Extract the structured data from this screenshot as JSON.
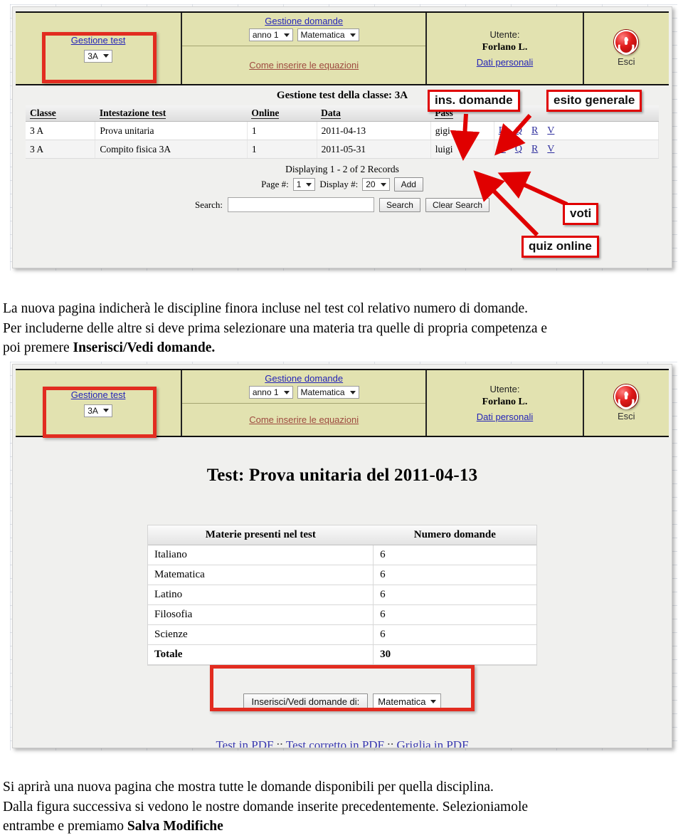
{
  "screenshot1": {
    "header": {
      "gestione_test_link": "Gestione test",
      "classe_select": "3A",
      "gestione_domande_link": "Gestione domande",
      "anno_select": "anno 1",
      "materia_select": "Matematica",
      "equazioni_link": "Come inserire le equazioni",
      "utente_label": "Utente:",
      "utente_name": "Forlano L.",
      "dati_personali_link": "Dati personali",
      "esci_label": "Esci",
      "power_icon": "power-icon"
    },
    "page_title": "Gestione test della classe: 3A",
    "table": {
      "columns": [
        "Classe",
        "Intestazione test",
        "Online",
        "Data",
        "Pass",
        ""
      ],
      "rows": [
        {
          "classe": "3 A",
          "intestazione": "Prova unitaria",
          "online": "1",
          "data": "2011-04-13",
          "pass": "gigi",
          "actions": [
            "D",
            "Q",
            "R",
            "V"
          ]
        },
        {
          "classe": "3 A",
          "intestazione": "Compito fisica 3A",
          "online": "1",
          "data": "2011-05-31",
          "pass": "luigi",
          "actions": [
            "D",
            "Q",
            "R",
            "V"
          ]
        }
      ]
    },
    "records_text": "Displaying 1 - 2 of 2 Records",
    "pager": {
      "page_label": "Page #:",
      "page_value": "1",
      "display_label": "Display #:",
      "display_value": "20",
      "add_button": "Add"
    },
    "search": {
      "label": "Search:",
      "value": "",
      "placeholder": "",
      "search_button": "Search",
      "clear_button": "Clear Search"
    },
    "annotations": [
      {
        "label": "ins. domande"
      },
      {
        "label": "esito generale"
      },
      {
        "label": "voti"
      },
      {
        "label": "quiz online"
      }
    ]
  },
  "paragraph1": {
    "line1": "La nuova pagina indicherà le discipline finora incluse nel test col relativo numero di domande.",
    "line2": "Per includerne delle altre si deve prima selezionare una materia tra quelle di propria competenza e",
    "line3_prefix": "poi premere ",
    "line3_bold": "Inserisci/Vedi domande."
  },
  "screenshot2": {
    "header": {
      "gestione_test_link": "Gestione test",
      "classe_select": "3A",
      "gestione_domande_link": "Gestione domande",
      "anno_select": "anno 1",
      "materia_select": "Matematica",
      "equazioni_link": "Come inserire le equazioni",
      "utente_label": "Utente:",
      "utente_name": "Forlano L.",
      "dati_personali_link": "Dati personali",
      "esci_label": "Esci",
      "power_icon": "power-icon"
    },
    "test_title": "Test: Prova unitaria del 2011-04-13",
    "materie_table": {
      "columns": [
        "Materie presenti nel test",
        "Numero domande"
      ],
      "rows": [
        {
          "materia": "Italiano",
          "numero": "6"
        },
        {
          "materia": "Matematica",
          "numero": "6"
        },
        {
          "materia": "Latino",
          "numero": "6"
        },
        {
          "materia": "Filosofia",
          "numero": "6"
        },
        {
          "materia": "Scienze",
          "numero": "6"
        },
        {
          "materia": "Totale",
          "numero": "30"
        }
      ]
    },
    "insert_button": "Inserisci/Vedi domande di:",
    "insert_select": "Matematica",
    "pdf_links": {
      "link1": "Test in PDF",
      "sep1": "::",
      "link2": "Test corretto in PDF",
      "sep2": "::",
      "link3": "Griglia in PDF"
    }
  },
  "paragraph2": {
    "line1": "Si aprirà una nuova pagina che mostra tutte le domande disponibili per quella disciplina.",
    "line2": "Dalla figura successiva si vedono le nostre domande inserite precedentemente. Selezioniamole",
    "line3_prefix": "entrambe e premiamo ",
    "line3_bold": "Salva Modifiche"
  },
  "colors": {
    "header_bg": "#e2e2b0",
    "accent_red": "#e22c20",
    "link_blue": "#2424b8",
    "link_brown": "#9d4a3f"
  }
}
